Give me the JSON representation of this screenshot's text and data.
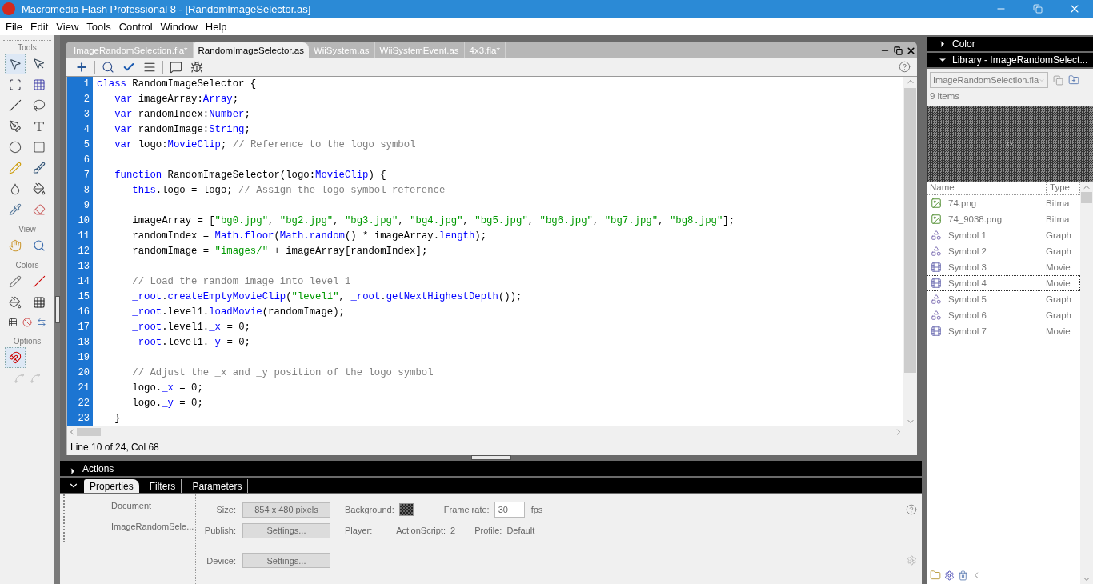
{
  "window": {
    "title": "Macromedia Flash Professional 8 - [RandomImageSelector.as]"
  },
  "menu": [
    "File",
    "Edit",
    "View",
    "Tools",
    "Control",
    "Window",
    "Help"
  ],
  "tools": {
    "sections": [
      {
        "label": "Tools",
        "items": [
          {
            "kind": "arrow",
            "selected": true
          },
          {
            "kind": "subselect",
            "selected": false
          },
          {
            "kind": "transform",
            "selected": false
          },
          {
            "kind": "gradient",
            "selected": false
          },
          {
            "kind": "line",
            "selected": false
          },
          {
            "kind": "lasso",
            "selected": false
          },
          {
            "kind": "pen",
            "selected": false
          },
          {
            "kind": "text",
            "selected": false
          },
          {
            "kind": "oval",
            "selected": false
          },
          {
            "kind": "rect",
            "selected": false
          },
          {
            "kind": "pencil",
            "selected": false
          },
          {
            "kind": "brush",
            "selected": false
          },
          {
            "kind": "ink",
            "selected": false
          },
          {
            "kind": "bucket",
            "selected": false
          },
          {
            "kind": "dropper",
            "selected": false
          },
          {
            "kind": "eraser",
            "selected": false
          }
        ]
      },
      {
        "label": "View",
        "items": [
          {
            "kind": "hand",
            "selected": false
          },
          {
            "kind": "zoom",
            "selected": false
          }
        ]
      },
      {
        "label": "Colors",
        "items": [
          {
            "kind": "stroke",
            "selected": false
          },
          {
            "kind": "stroke-swatch",
            "selected": false
          },
          {
            "kind": "fill",
            "selected": false
          },
          {
            "kind": "fill-swatch",
            "selected": false
          }
        ]
      },
      {
        "label": "Options",
        "items": [
          {
            "kind": "magnet",
            "selected": true
          }
        ]
      }
    ]
  },
  "document_tabs": [
    {
      "label": "ImageRandomSelection.fla*",
      "selected": false
    },
    {
      "label": "RandomImageSelector.as",
      "selected": true
    },
    {
      "label": "WiiSystem.as",
      "selected": false
    },
    {
      "label": "WiiSystemEvent.as",
      "selected": false
    },
    {
      "label": "4x3.fla*",
      "selected": false
    }
  ],
  "code": {
    "lines": [
      {
        "number": "1",
        "tokens": [
          {
            "kind": "keyword",
            "text": "class"
          },
          {
            "kind": "text",
            "text": " RandomImageSelector {"
          }
        ]
      },
      {
        "number": "2",
        "tokens": [
          {
            "kind": "keyword",
            "text": "   var"
          },
          {
            "kind": "text",
            "text": " imageArray:"
          },
          {
            "kind": "keyword",
            "text": "Array"
          },
          {
            "kind": "text",
            "text": ";"
          }
        ]
      },
      {
        "number": "3",
        "tokens": [
          {
            "kind": "keyword",
            "text": "   var"
          },
          {
            "kind": "text",
            "text": " randomIndex:"
          },
          {
            "kind": "keyword",
            "text": "Number"
          },
          {
            "kind": "text",
            "text": ";"
          }
        ]
      },
      {
        "number": "4",
        "tokens": [
          {
            "kind": "keyword",
            "text": "   var"
          },
          {
            "kind": "text",
            "text": " randomImage:"
          },
          {
            "kind": "keyword",
            "text": "String"
          },
          {
            "kind": "text",
            "text": ";"
          }
        ]
      },
      {
        "number": "5",
        "tokens": [
          {
            "kind": "keyword",
            "text": "   var"
          },
          {
            "kind": "text",
            "text": " logo:"
          },
          {
            "kind": "keyword",
            "text": "MovieClip"
          },
          {
            "kind": "text",
            "text": "; "
          },
          {
            "kind": "comment",
            "text": "// Reference to the logo symbol"
          }
        ]
      },
      {
        "number": "6"
      },
      {
        "number": "7",
        "tokens": [
          {
            "kind": "keyword",
            "text": "   function"
          },
          {
            "kind": "text",
            "text": " RandomImageSelector(logo:"
          },
          {
            "kind": "keyword",
            "text": "MovieClip"
          },
          {
            "kind": "text",
            "text": ") {"
          }
        ]
      },
      {
        "number": "8",
        "tokens": [
          {
            "kind": "keyword",
            "text": "      this"
          },
          {
            "kind": "text",
            "text": ".logo = logo; "
          },
          {
            "kind": "comment",
            "text": "// Assign the logo symbol reference"
          }
        ]
      },
      {
        "number": "9"
      },
      {
        "number": "10",
        "tokens": [
          {
            "kind": "text",
            "text": "      imageArray = ["
          },
          {
            "kind": "string",
            "text": "\"bg0.jpg\""
          },
          {
            "kind": "text",
            "text": ", "
          },
          {
            "kind": "string",
            "text": "\"bg2.jpg\""
          },
          {
            "kind": "text",
            "text": ", "
          },
          {
            "kind": "string",
            "text": "\"bg3.jpg\""
          },
          {
            "kind": "text",
            "text": ", "
          },
          {
            "kind": "string",
            "text": "\"bg4.jpg\""
          },
          {
            "kind": "text",
            "text": ", "
          },
          {
            "kind": "string",
            "text": "\"bg5.jpg\""
          },
          {
            "kind": "text",
            "text": ", "
          },
          {
            "kind": "string",
            "text": "\"bg6.jpg\""
          },
          {
            "kind": "text",
            "text": ", "
          },
          {
            "kind": "string",
            "text": "\"bg7.jpg\""
          },
          {
            "kind": "text",
            "text": ", "
          },
          {
            "kind": "string",
            "text": "\"bg8.jpg\""
          },
          {
            "kind": "text",
            "text": "];"
          }
        ]
      },
      {
        "number": "11",
        "tokens": [
          {
            "kind": "text",
            "text": "      randomIndex = "
          },
          {
            "kind": "keyword",
            "text": "Math.floor"
          },
          {
            "kind": "text",
            "text": "("
          },
          {
            "kind": "keyword",
            "text": "Math.random"
          },
          {
            "kind": "text",
            "text": "() * imageArray."
          },
          {
            "kind": "keyword",
            "text": "length"
          },
          {
            "kind": "text",
            "text": ");"
          }
        ]
      },
      {
        "number": "12",
        "tokens": [
          {
            "kind": "text",
            "text": "      randomImage = "
          },
          {
            "kind": "string",
            "text": "\"images/\""
          },
          {
            "kind": "text",
            "text": " + imageArray[randomIndex];"
          }
        ]
      },
      {
        "number": "13"
      },
      {
        "number": "14",
        "tokens": [
          {
            "kind": "comment",
            "text": "      // Load the random image into level 1"
          }
        ]
      },
      {
        "number": "15",
        "tokens": [
          {
            "kind": "keyword",
            "text": "      _root"
          },
          {
            "kind": "text",
            "text": "."
          },
          {
            "kind": "keyword",
            "text": "createEmptyMovieClip"
          },
          {
            "kind": "text",
            "text": "("
          },
          {
            "kind": "string",
            "text": "\"level1\""
          },
          {
            "kind": "text",
            "text": ", "
          },
          {
            "kind": "keyword",
            "text": "_root"
          },
          {
            "kind": "text",
            "text": "."
          },
          {
            "kind": "keyword",
            "text": "getNextHighestDepth"
          },
          {
            "kind": "text",
            "text": "());"
          }
        ]
      },
      {
        "number": "16",
        "tokens": [
          {
            "kind": "keyword",
            "text": "      _root"
          },
          {
            "kind": "text",
            "text": ".level1."
          },
          {
            "kind": "keyword",
            "text": "loadMovie"
          },
          {
            "kind": "text",
            "text": "(randomImage);"
          }
        ]
      },
      {
        "number": "17",
        "tokens": [
          {
            "kind": "keyword",
            "text": "      _root"
          },
          {
            "kind": "text",
            "text": ".level1."
          },
          {
            "kind": "keyword",
            "text": "_x"
          },
          {
            "kind": "text",
            "text": " = 0;"
          }
        ]
      },
      {
        "number": "18",
        "tokens": [
          {
            "kind": "keyword",
            "text": "      _root"
          },
          {
            "kind": "text",
            "text": ".level1."
          },
          {
            "kind": "keyword",
            "text": "_y"
          },
          {
            "kind": "text",
            "text": " = 0;"
          }
        ]
      },
      {
        "number": "19"
      },
      {
        "number": "20",
        "tokens": [
          {
            "kind": "comment",
            "text": "      // Adjust the _x and _y position of the logo symbol"
          }
        ]
      },
      {
        "number": "21",
        "tokens": [
          {
            "kind": "text",
            "text": "      logo."
          },
          {
            "kind": "keyword",
            "text": "_x"
          },
          {
            "kind": "text",
            "text": " = 0;"
          }
        ]
      },
      {
        "number": "22",
        "tokens": [
          {
            "kind": "text",
            "text": "      logo."
          },
          {
            "kind": "keyword",
            "text": "_y"
          },
          {
            "kind": "text",
            "text": " = 0;"
          }
        ]
      },
      {
        "number": "23",
        "tokens": [
          {
            "kind": "text",
            "text": "   }"
          }
        ]
      }
    ]
  },
  "status_bar": "Line 10 of 24, Col 68",
  "actions_panel": {
    "title": "Actions",
    "expanded": false
  },
  "properties_panel": {
    "tabs": [
      {
        "label": "Properties",
        "selected": true
      },
      {
        "label": "Filters",
        "selected": false
      },
      {
        "label": "Parameters",
        "selected": false
      }
    ],
    "document_label": "Document",
    "document_name": "ImageRandomSele...",
    "size_label": "Size:",
    "size_value": "854 x 480 pixels",
    "background_label": "Background:",
    "frame_rate_label": "Frame rate:",
    "frame_rate": "30",
    "fps_label": "fps",
    "publish_label": "Publish:",
    "publish_button": "Settings...",
    "player_label": "Player:",
    "actionscript_label": "ActionScript:",
    "actionscript_value": "2",
    "profile_label": "Profile:",
    "profile_value": "Default",
    "device_label": "Device:",
    "device_button": "Settings..."
  },
  "color_panel": {
    "title": "Color",
    "expanded": false
  },
  "library_panel": {
    "title": "Library - ImageRandomSelect...",
    "expanded": true,
    "document": "ImageRandomSelection.fla",
    "count": "9 items",
    "columns": [
      "Name",
      "Type"
    ],
    "items": [
      {
        "kind": "bitmap",
        "name": "74.png",
        "type": "Bitma",
        "selected": false
      },
      {
        "kind": "bitmap",
        "name": "74_9038.png",
        "type": "Bitma",
        "selected": false
      },
      {
        "kind": "graphic",
        "name": "Symbol 1",
        "type": "Graph",
        "selected": false
      },
      {
        "kind": "graphic",
        "name": "Symbol 2",
        "type": "Graph",
        "selected": false
      },
      {
        "kind": "movie",
        "name": "Symbol 3",
        "type": "Movie",
        "selected": false
      },
      {
        "kind": "movie",
        "name": "Symbol 4",
        "type": "Movie",
        "selected": true
      },
      {
        "kind": "graphic",
        "name": "Symbol 5",
        "type": "Graph",
        "selected": false
      },
      {
        "kind": "graphic",
        "name": "Symbol 6",
        "type": "Graph",
        "selected": false
      },
      {
        "kind": "movie",
        "name": "Symbol 7",
        "type": "Movie",
        "selected": false
      }
    ]
  }
}
